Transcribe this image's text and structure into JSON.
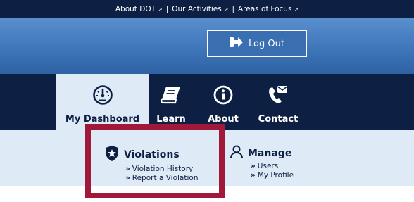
{
  "topbar": {
    "links": [
      "About DOT",
      "Our Activities",
      "Areas of Focus"
    ],
    "separator": "|"
  },
  "header": {
    "logout_label": "Log Out"
  },
  "nav": {
    "items": [
      {
        "label": "My Dashboard",
        "icon": "speedometer-icon"
      },
      {
        "label": "Learn",
        "icon": "book-icon"
      },
      {
        "label": "About",
        "icon": "info-icon"
      },
      {
        "label": "Contact",
        "icon": "phone-mail-icon"
      }
    ]
  },
  "submenu": {
    "violations": {
      "title": "Violations",
      "icon": "shield-star-icon",
      "links": [
        "Violation History",
        "Report a Violation"
      ]
    },
    "manage": {
      "title": "Manage",
      "icon": "user-icon",
      "links": [
        "Users",
        "My Profile"
      ]
    }
  },
  "colors": {
    "navy": "#0d1f43",
    "header_blue": "#3f76ba",
    "submenu_bg": "#dfeaf7",
    "highlight": "#a0183a"
  }
}
